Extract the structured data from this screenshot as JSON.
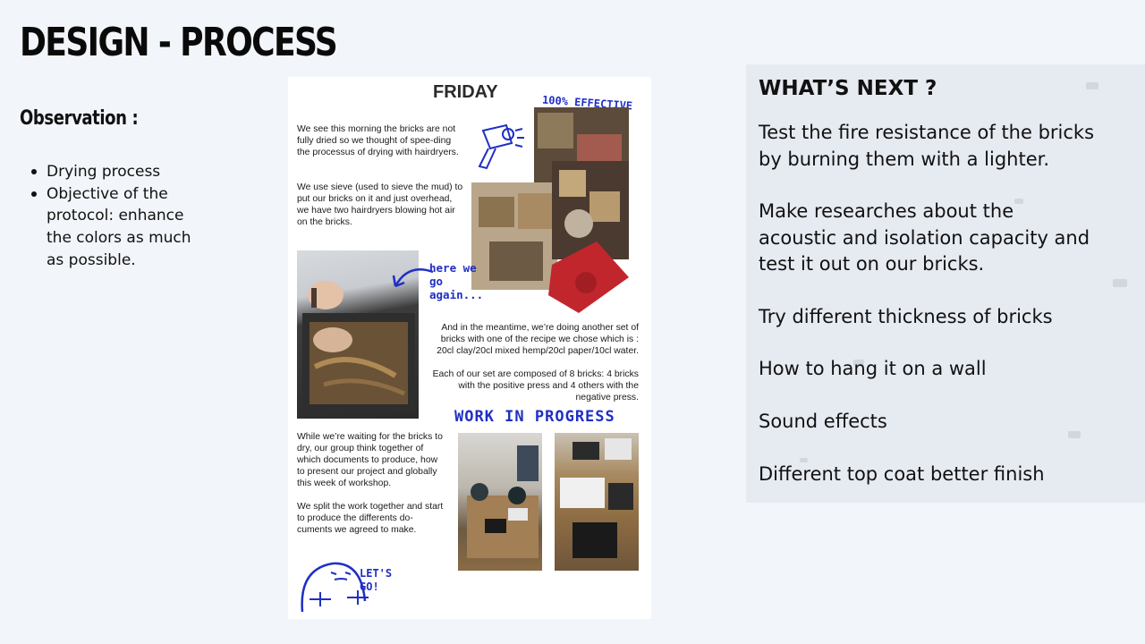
{
  "title": "DESIGN - PROCESS",
  "observation": {
    "heading": "Observation :",
    "items": [
      "Drying process",
      "Objective of the protocol: enhance the colors as much as possible."
    ]
  },
  "journal": {
    "title": "FRIDAY",
    "para1": "We see this morning the bricks are not fully dried so we thought of spee-ding the processus of drying with hairdryers.",
    "para2": "We use sieve (used to sieve the mud) to put our bricks on it and just overhead, we have two hairdryers blowing hot air on the bricks.",
    "para3": "And in the meantime, we’re doing another set of bricks with one of the recipe we chose which is : 20cl clay/20cl mixed hemp/20cl paper/10cl water.",
    "para4": "Each of our set are composed of 8 bricks: 4 bricks with the positive press and 4 others with the negative press.",
    "para5": "While we’re waiting for the bricks to dry, our group think together of which documents to produce, how to present our project and globally this week of workshop.",
    "para6": "We split the work together and start to produce the differents do-cuments we agreed to make.",
    "hand_effective": "100% EFFECTIVE",
    "hand_here": "here we go again...",
    "hand_wip": "WORK IN PROGRESS",
    "hand_lets": "LET'S GO!"
  },
  "whats_next": {
    "title": "WHAT’S NEXT ?",
    "items": [
      "Test the fire resistance of the bricks by burning them with a lighter.",
      "Make researches about the acoustic and isolation capacity and test it out on our bricks.",
      "Try different thickness of bricks",
      "How to hang it on a wall",
      "Sound effects",
      "Different top coat better finish"
    ]
  }
}
